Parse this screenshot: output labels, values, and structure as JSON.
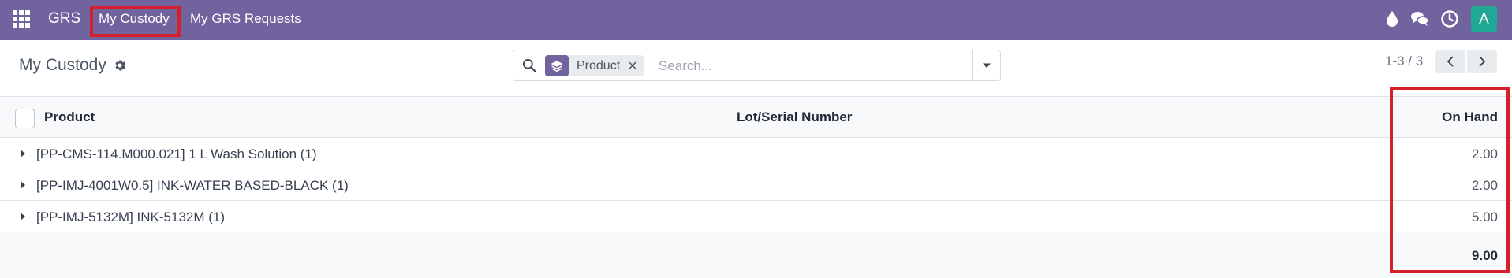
{
  "navbar": {
    "brand": "GRS",
    "menu": [
      {
        "label": "My Custody"
      },
      {
        "label": "My GRS Requests"
      }
    ],
    "icons": [
      "apps-grid-icon",
      "water-drop-icon",
      "chat-icon",
      "clock-icon"
    ],
    "avatar_initial": "A",
    "colors": {
      "navbar": "#71639e",
      "avatar": "#1fa894",
      "highlight": "#d3202a"
    }
  },
  "control_panel": {
    "title": "My Custody",
    "search": {
      "facet_label": "Product",
      "placeholder": "Search..."
    },
    "pager": {
      "value": "1-3 / 3"
    }
  },
  "list": {
    "columns": [
      "Product",
      "Lot/Serial Number",
      "On Hand"
    ],
    "groups": [
      {
        "label": "[PP-CMS-114.M000.021] 1 L Wash Solution (1)",
        "on_hand": "2.00"
      },
      {
        "label": "[PP-IMJ-4001W0.5] INK-WATER BASED-BLACK (1)",
        "on_hand": "2.00"
      },
      {
        "label": "[PP-IMJ-5132M] INK-5132M (1)",
        "on_hand": "5.00"
      }
    ],
    "total": "9.00"
  }
}
